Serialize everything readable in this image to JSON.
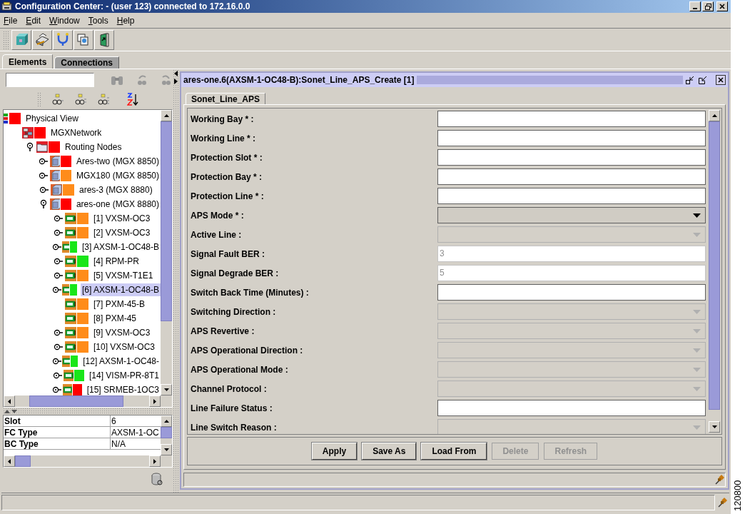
{
  "window": {
    "title": "Configuration Center: - (user 123) connected to 172.16.0.0"
  },
  "menu": [
    "File",
    "Edit",
    "Window",
    "Tools",
    "Help"
  ],
  "tabs": [
    {
      "label": "Elements",
      "selected": true
    },
    {
      "label": "Connections",
      "selected": false
    }
  ],
  "tree": [
    {
      "label": "Physical View",
      "kind": "view",
      "color": "#ff0000",
      "children": [
        {
          "label": "MGXNetwork",
          "kind": "network",
          "color": "#ff0000",
          "children": [
            {
              "label": "Routing Nodes",
              "kind": "folder",
              "color": "#ff0000",
              "expanded": true,
              "children": [
                {
                  "label": "Ares-two (MGX 8850)",
                  "kind": "node",
                  "color": "#ff0000",
                  "expanded": false
                },
                {
                  "label": "MGX180 (MGX 8850)",
                  "kind": "node",
                  "color": "#ff8c1a",
                  "expanded": false
                },
                {
                  "label": "ares-3 (MGX 8880)",
                  "kind": "node",
                  "color": "#ff8c1a",
                  "expanded": false
                },
                {
                  "label": "ares-one (MGX 8880)",
                  "kind": "node",
                  "color": "#ff0000",
                  "expanded": true,
                  "children": [
                    {
                      "label": "[1] VXSM-OC3",
                      "kind": "card",
                      "color": "#ff8c1a",
                      "expanded": false,
                      "selected": false
                    },
                    {
                      "label": "[2] VXSM-OC3",
                      "kind": "card",
                      "color": "#ff8c1a",
                      "expanded": false,
                      "selected": false
                    },
                    {
                      "label": "[3] AXSM-1-OC48-B",
                      "kind": "card",
                      "color": "#19e619",
                      "expanded": false,
                      "selected": false
                    },
                    {
                      "label": "[4] RPM-PR",
                      "kind": "card",
                      "color": "#19e619",
                      "expanded": false,
                      "selected": false
                    },
                    {
                      "label": "[5] VXSM-T1E1",
                      "kind": "card",
                      "color": "#ff8c1a",
                      "expanded": false,
                      "selected": false
                    },
                    {
                      "label": "[6] AXSM-1-OC48-B",
                      "kind": "card",
                      "color": "#19e619",
                      "expanded": false,
                      "selected": true
                    },
                    {
                      "label": "[7] PXM-45-B",
                      "kind": "card",
                      "color": "#ff8c1a",
                      "selected": false
                    },
                    {
                      "label": "[8] PXM-45",
                      "kind": "card",
                      "color": "#ff8c1a",
                      "selected": false
                    },
                    {
                      "label": "[9] VXSM-OC3",
                      "kind": "card",
                      "color": "#ff8c1a",
                      "expanded": false,
                      "selected": false
                    },
                    {
                      "label": "[10] VXSM-OC3",
                      "kind": "card",
                      "color": "#ff8c1a",
                      "expanded": false,
                      "selected": false
                    },
                    {
                      "label": "[12] AXSM-1-OC48-",
                      "kind": "card",
                      "color": "#19e619",
                      "expanded": false,
                      "selected": false
                    },
                    {
                      "label": "[14] VISM-PR-8T1",
                      "kind": "card",
                      "color": "#19e619",
                      "expanded": false,
                      "selected": false
                    },
                    {
                      "label": "[15] SRMEB-1OC3",
                      "kind": "card",
                      "color": "#ff0000",
                      "expanded": false,
                      "selected": false
                    }
                  ]
                }
              ]
            }
          ]
        }
      ]
    }
  ],
  "properties": [
    {
      "name": "Slot",
      "value": "6"
    },
    {
      "name": "FC Type",
      "value": "AXSM-1-OC"
    },
    {
      "name": "BC Type",
      "value": "N/A"
    }
  ],
  "frame": {
    "title": "ares-one.6(AXSM-1-OC48-B):Sonet_Line_APS_Create [1]",
    "tab": "Sonet_Line_APS"
  },
  "fields": [
    {
      "label": "Working Bay * :",
      "kind": "text",
      "disabled": false
    },
    {
      "label": "Working Line * :",
      "kind": "text",
      "disabled": false
    },
    {
      "label": "Protection Slot * :",
      "kind": "text",
      "disabled": false
    },
    {
      "label": "Protection Bay * :",
      "kind": "text",
      "disabled": false
    },
    {
      "label": "Protection Line * :",
      "kind": "text",
      "disabled": false
    },
    {
      "label": "APS Mode * :",
      "kind": "select",
      "disabled": false
    },
    {
      "label": "Active Line :",
      "kind": "select",
      "disabled": true
    },
    {
      "label": "Signal Fault BER :",
      "kind": "text",
      "disabled": true,
      "value": "3"
    },
    {
      "label": "Signal Degrade BER :",
      "kind": "text",
      "disabled": true,
      "value": "5"
    },
    {
      "label": "Switch Back Time (Minutes) :",
      "kind": "text",
      "disabled": false
    },
    {
      "label": "Switching Direction :",
      "kind": "select",
      "disabled": true
    },
    {
      "label": "APS Revertive :",
      "kind": "select",
      "disabled": true
    },
    {
      "label": "APS Operational Direction :",
      "kind": "select",
      "disabled": true
    },
    {
      "label": "APS Operational Mode :",
      "kind": "select",
      "disabled": true
    },
    {
      "label": "Channel Protocol :",
      "kind": "select",
      "disabled": true
    },
    {
      "label": "Line Failure Status :",
      "kind": "text",
      "disabled": false
    },
    {
      "label": "Line Switch Reason :",
      "kind": "select",
      "disabled": true
    }
  ],
  "buttons": [
    {
      "label": "Apply",
      "disabled": false
    },
    {
      "label": "Save As",
      "disabled": false
    },
    {
      "label": "Load From",
      "disabled": false
    },
    {
      "label": "Delete",
      "disabled": true
    },
    {
      "label": "Refresh",
      "disabled": true
    }
  ],
  "figure_number": "120800"
}
